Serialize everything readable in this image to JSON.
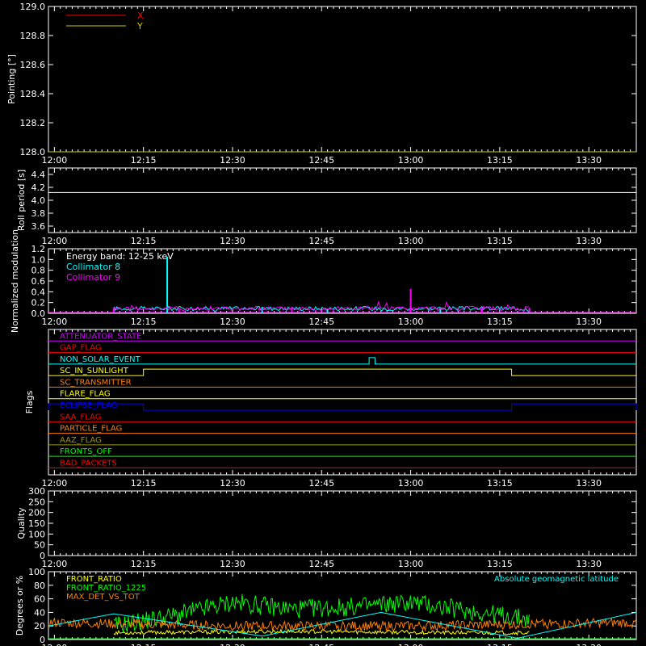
{
  "time_ticks": [
    "12:00",
    "12:15",
    "12:30",
    "12:45",
    "13:00",
    "13:15",
    "13:30"
  ],
  "chart_data": [
    {
      "type": "line",
      "ylabel": "Pointing [°]",
      "ylim": [
        128.0,
        129.0
      ],
      "yticks": [
        "128.0",
        "128.2",
        "128.4",
        "128.6",
        "128.8",
        "129.0"
      ],
      "legend": "top-left",
      "series": [
        {
          "name": "X",
          "color": "#ff0000",
          "x": [],
          "y": []
        },
        {
          "name": "Y",
          "color": "#cccc00",
          "x": [],
          "y": []
        }
      ]
    },
    {
      "type": "line",
      "ylabel": "Roll period [s]",
      "ylim": [
        3.5,
        4.5
      ],
      "yticks": [
        "3.6",
        "3.8",
        "4.0",
        "4.2",
        "4.4"
      ],
      "series": [
        {
          "color": "#ffffff",
          "x": [
            "11:59",
            "13:38"
          ],
          "y": [
            4.12,
            4.12
          ]
        }
      ]
    },
    {
      "type": "line",
      "ylabel": "Normalized modulation",
      "ylim": [
        0.0,
        1.2
      ],
      "yticks": [
        "0.0",
        "0.2",
        "0.4",
        "0.6",
        "0.8",
        "1.0",
        "1.2"
      ],
      "annotation": "Energy band: 12-25 keV",
      "legend": "top-left",
      "series": [
        {
          "name": "Collimator 8",
          "color": "#00ffff",
          "x": [
            "12:10",
            "12:19",
            "12:35",
            "12:46",
            "13:05",
            "13:20"
          ],
          "y": [
            0.08,
            1.05,
            0.12,
            0.08,
            0.1,
            0.08
          ]
        },
        {
          "name": "Collimator 9",
          "color": "#ff00ff",
          "x": [
            "12:10",
            "12:21",
            "12:40",
            "13:00",
            "13:12",
            "13:20"
          ],
          "y": [
            0.1,
            0.1,
            0.12,
            0.45,
            0.1,
            0.1
          ]
        }
      ],
      "data_range": [
        "12:10",
        "13:20"
      ]
    },
    {
      "type": "line",
      "ylabel": "Flags",
      "flags": [
        {
          "name": "ATTENUATOR_STATE",
          "color": "#cc00ff",
          "steps": []
        },
        {
          "name": "GAP_FLAG",
          "color": "#ff0000",
          "steps": []
        },
        {
          "name": "NON_SOLAR_EVENT",
          "color": "#00ffff",
          "steps": [
            [
              "12:53",
              "12:54"
            ]
          ]
        },
        {
          "name": "SC_IN_SUNLIGHT",
          "color": "#ffff00",
          "steps": [
            [
              "12:15",
              "13:17"
            ]
          ]
        },
        {
          "name": "SC_TRANSMITTER",
          "color": "#ff8000",
          "steps": []
        },
        {
          "name": "FLARE_FLAG",
          "color": "#ffff00",
          "steps": []
        },
        {
          "name": "ECLIPSE_FLAG",
          "color": "#0000ff",
          "steps": [
            [
              "11:59",
              "12:15"
            ],
            [
              "13:17",
              "13:38"
            ]
          ]
        },
        {
          "name": "SAA_FLAG",
          "color": "#ff0000",
          "steps": []
        },
        {
          "name": "PARTICLE_FLAG",
          "color": "#ff8000",
          "steps": []
        },
        {
          "name": "AAZ_FLAG",
          "color": "#999900",
          "steps": []
        },
        {
          "name": "FRONTS_OFF",
          "color": "#00ff00",
          "steps": []
        },
        {
          "name": "BAD_PACKETS",
          "color": "#ff0000",
          "steps": []
        }
      ]
    },
    {
      "type": "line",
      "ylabel": "Quality",
      "ylim": [
        0,
        300
      ],
      "yticks": [
        "0",
        "50",
        "100",
        "150",
        "200",
        "250",
        "300"
      ],
      "series": [
        {
          "color": "#ffffff",
          "x": [
            "11:59",
            "13:38"
          ],
          "y": [
            0,
            0
          ]
        }
      ]
    },
    {
      "type": "line",
      "ylabel": "Degrees or %",
      "ylim": [
        0,
        100
      ],
      "yticks": [
        "0",
        "20",
        "40",
        "60",
        "80",
        "100"
      ],
      "legend": "top-left",
      "series": [
        {
          "name": "FRONT_RATIO",
          "color": "#ffff00",
          "x": [
            "12:10",
            "12:40",
            "13:10",
            "13:20"
          ],
          "y": [
            10,
            12,
            10,
            10
          ]
        },
        {
          "name": "FRONT_RATIO_1225",
          "color": "#00ff00",
          "x": [
            "12:10",
            "12:20",
            "12:30",
            "12:40",
            "12:50",
            "13:00",
            "13:10",
            "13:20"
          ],
          "y": [
            20,
            35,
            55,
            45,
            48,
            55,
            42,
            30
          ]
        },
        {
          "name": "MAX_DET_VS_TOT",
          "color": "#ff8000",
          "x": [
            "11:59",
            "12:30",
            "13:00",
            "13:38"
          ],
          "y": [
            25,
            20,
            20,
            25
          ]
        },
        {
          "name": "Absolute geomagnetic latitude",
          "color": "#00ffff",
          "x": [
            "11:59",
            "12:10",
            "12:35",
            "12:55",
            "13:18",
            "13:38"
          ],
          "y": [
            20,
            38,
            5,
            40,
            2,
            40
          ]
        }
      ]
    }
  ]
}
